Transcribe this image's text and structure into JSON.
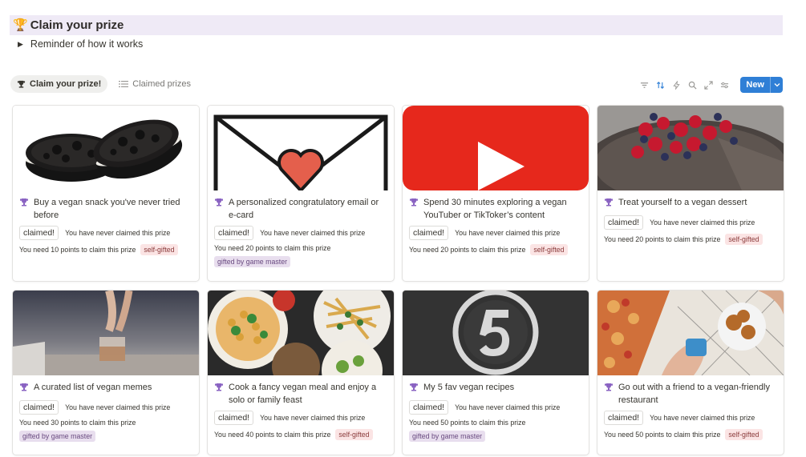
{
  "page": {
    "trophy": "🏆",
    "title": "Claim your prize",
    "toggle_label": "Reminder of how it works"
  },
  "views": {
    "active": "Claim your prize!",
    "other": "Claimed prizes"
  },
  "toolbar": {
    "new_label": "New"
  },
  "cards": [
    {
      "title": "Buy a vegan snack you've never tried before",
      "claimed": "claimed!",
      "never": "You have never claimed this prize",
      "points": "You need 10 points to claim this prize",
      "tag": "self-gifted",
      "tag_type": "self",
      "image": "oreo-cookies"
    },
    {
      "title": "A personalized congratulatory email or e-card",
      "claimed": "claimed!",
      "never": "You have never claimed this prize",
      "points": "You need 20 points to claim this prize",
      "tag": "gifted by game master",
      "tag_type": "gm",
      "image": "envelope-heart"
    },
    {
      "title": "Spend 30 minutes exploring a vegan YouTuber or TikToker’s content",
      "claimed": "claimed!",
      "never": "You have never claimed this prize",
      "points": "You need 20 points to claim this prize",
      "tag": "self-gifted",
      "tag_type": "self",
      "image": "youtube-logo"
    },
    {
      "title": "Treat yourself to a vegan dessert",
      "claimed": "claimed!",
      "never": "You have never claimed this prize",
      "points": "You need 20 points to claim this prize",
      "tag": "self-gifted",
      "tag_type": "self",
      "image": "berry-cake"
    },
    {
      "title": "A curated list of vegan memes",
      "claimed": "claimed!",
      "never": "You have never claimed this prize",
      "points": "You need 30 points to claim this prize",
      "tag": "gifted by game master",
      "tag_type": "gm",
      "image": "tiny-glass"
    },
    {
      "title": "Cook a fancy vegan meal and enjoy a solo or family feast",
      "claimed": "claimed!",
      "never": "You have never claimed this prize",
      "points": "You need 40 points to claim this prize",
      "tag": "self-gifted",
      "tag_type": "self",
      "image": "vegan-meal"
    },
    {
      "title": "My 5 fav vegan recipes",
      "claimed": "claimed!",
      "never": "You have never claimed this prize",
      "points": "You need 50 points to claim this prize",
      "tag": "gifted by game master",
      "tag_type": "gm",
      "image": "number-five"
    },
    {
      "title": "Go out with a friend to a vegan-friendly restaurant",
      "claimed": "claimed!",
      "never": "You have never claimed this prize",
      "points": "You need 50 points to claim this prize",
      "tag": "self-gifted",
      "tag_type": "self",
      "image": "restaurant-food"
    }
  ],
  "colors": {
    "accent": "#2f7fd6",
    "header_bg": "#efeaf6",
    "self_tag_bg": "#fbe4e4",
    "gm_tag_bg": "#e8deee"
  }
}
